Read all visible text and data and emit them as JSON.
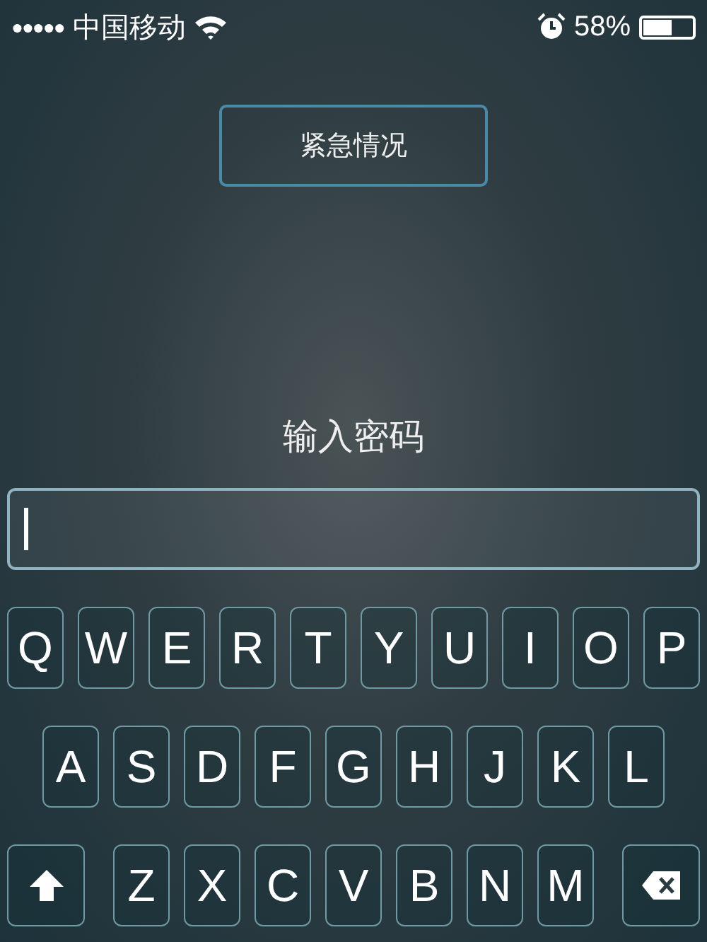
{
  "status_bar": {
    "signal_dots": "●●●●●",
    "carrier": "中国移动",
    "battery": {
      "text": "58%",
      "level": 0.58
    }
  },
  "emergency_button": "紧急情况",
  "prompt": "输入密码",
  "keyboard": {
    "rows": [
      {
        "keys": [
          {
            "kind": "letter",
            "label": "Q"
          },
          {
            "kind": "letter",
            "label": "W"
          },
          {
            "kind": "letter",
            "label": "E"
          },
          {
            "kind": "letter",
            "label": "R"
          },
          {
            "kind": "letter",
            "label": "T"
          },
          {
            "kind": "letter",
            "label": "Y"
          },
          {
            "kind": "letter",
            "label": "U"
          },
          {
            "kind": "letter",
            "label": "I"
          },
          {
            "kind": "letter",
            "label": "O"
          },
          {
            "kind": "letter",
            "label": "P"
          }
        ]
      },
      {
        "keys": [
          {
            "kind": "letter",
            "label": "A"
          },
          {
            "kind": "letter",
            "label": "S"
          },
          {
            "kind": "letter",
            "label": "D"
          },
          {
            "kind": "letter",
            "label": "F"
          },
          {
            "kind": "letter",
            "label": "G"
          },
          {
            "kind": "letter",
            "label": "H"
          },
          {
            "kind": "letter",
            "label": "J"
          },
          {
            "kind": "letter",
            "label": "K"
          },
          {
            "kind": "letter",
            "label": "L"
          }
        ]
      },
      {
        "keys": [
          {
            "kind": "shift"
          },
          {
            "kind": "letter",
            "label": "Z"
          },
          {
            "kind": "letter",
            "label": "X"
          },
          {
            "kind": "letter",
            "label": "C"
          },
          {
            "kind": "letter",
            "label": "V"
          },
          {
            "kind": "letter",
            "label": "B"
          },
          {
            "kind": "letter",
            "label": "N"
          },
          {
            "kind": "letter",
            "label": "M"
          },
          {
            "kind": "delete"
          }
        ]
      }
    ]
  }
}
